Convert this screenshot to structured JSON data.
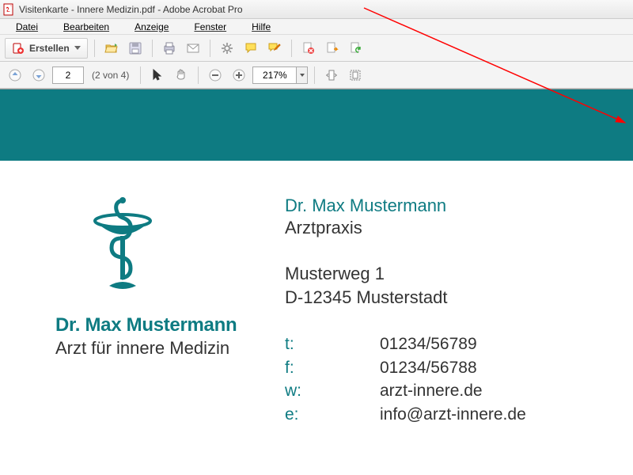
{
  "window": {
    "title": "Visitenkarte - Innere Medizin.pdf - Adobe Acrobat Pro"
  },
  "menu": {
    "datei": "Datei",
    "bearbeiten": "Bearbeiten",
    "anzeige": "Anzeige",
    "fenster": "Fenster",
    "hilfe": "Hilfe"
  },
  "toolbar": {
    "create": "Erstellen"
  },
  "nav": {
    "page_current": "2",
    "page_count": "(2 von 4)",
    "zoom": "217%"
  },
  "card": {
    "left": {
      "name": "Dr. Max Mustermann",
      "sub": "Arzt für innere Medizin"
    },
    "right": {
      "name": "Dr. Max Mustermann",
      "praxis": "Arztpraxis",
      "street": "Musterweg 1",
      "city": "D-12345 Musterstadt",
      "contacts": {
        "t_lbl": "t:",
        "t_val": "01234/56789",
        "f_lbl": "f:",
        "f_val": "01234/56788",
        "w_lbl": "w:",
        "w_val": "arzt-innere.de",
        "e_lbl": "e:",
        "e_val": "info@arzt-innere.de"
      }
    }
  }
}
